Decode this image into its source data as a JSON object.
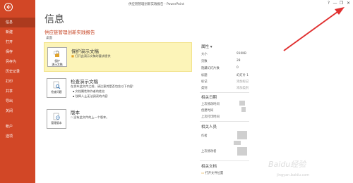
{
  "titlebar": {
    "title": "供应链管理创新实践报告 - PowerPoint",
    "help": "?",
    "minimize": "—",
    "restore": "❐",
    "close": "✕"
  },
  "sidebar": {
    "items": [
      {
        "label": "信息",
        "active": true
      },
      {
        "label": "新建"
      },
      {
        "label": "打开"
      },
      {
        "label": "保存"
      },
      {
        "label": "另存为"
      },
      {
        "label": "历史记录"
      },
      {
        "label": "打印"
      },
      {
        "label": "共享"
      },
      {
        "label": "导出"
      },
      {
        "label": "关闭"
      },
      {
        "label": "帐户"
      },
      {
        "label": "选项"
      }
    ]
  },
  "main": {
    "page_title": "信息",
    "doc_title": "供应链管理创新实践报告",
    "doc_path": "桌面",
    "protect": {
      "button": "保护\n演示文稿",
      "heading": "保护演示文稿",
      "desc": "打开此演示文稿时要求提供"
    },
    "inspect": {
      "button": "检查问题",
      "heading": "检查演示文稿",
      "desc": "在发布此文件之前，请注意其是否包含以下内容:",
      "b1": "文档属性和作者的姓名",
      "b2": "残障人士无法阅读的内容"
    },
    "versions": {
      "button": "管理版本",
      "heading": "版本",
      "desc": "没有此文件的上一个版本。"
    }
  },
  "properties": {
    "heading": "属性",
    "rows": [
      {
        "label": "大小",
        "value": "910KB"
      },
      {
        "label": "页数",
        "value": "28"
      },
      {
        "label": "隐藏幻灯片数",
        "value": "0"
      },
      {
        "label": "标题",
        "value": "幻灯片 1"
      },
      {
        "label": "标记",
        "value": "添加标记"
      },
      {
        "label": "类别",
        "value": "添加类别"
      }
    ],
    "dates_heading": "相关日期",
    "dates": [
      {
        "label": "上次修改时间"
      },
      {
        "label": "创建时间"
      },
      {
        "label": "上次打印时间"
      }
    ],
    "people_heading": "相关人员",
    "people": [
      {
        "label": "作者"
      },
      {
        "label": "上次修改者"
      }
    ],
    "docs_heading": "相关文档",
    "open_location": "打开文件位置"
  },
  "watermark": {
    "logo": "Baidu经验",
    "url": "jingyan.baidu.com"
  },
  "colors": {
    "sidebar": "#d24726",
    "sidebar_active": "#ac3a1e",
    "highlight_card": "#fcf4b8",
    "accent_text": "#c43e1c",
    "arrow": "#e03030"
  }
}
